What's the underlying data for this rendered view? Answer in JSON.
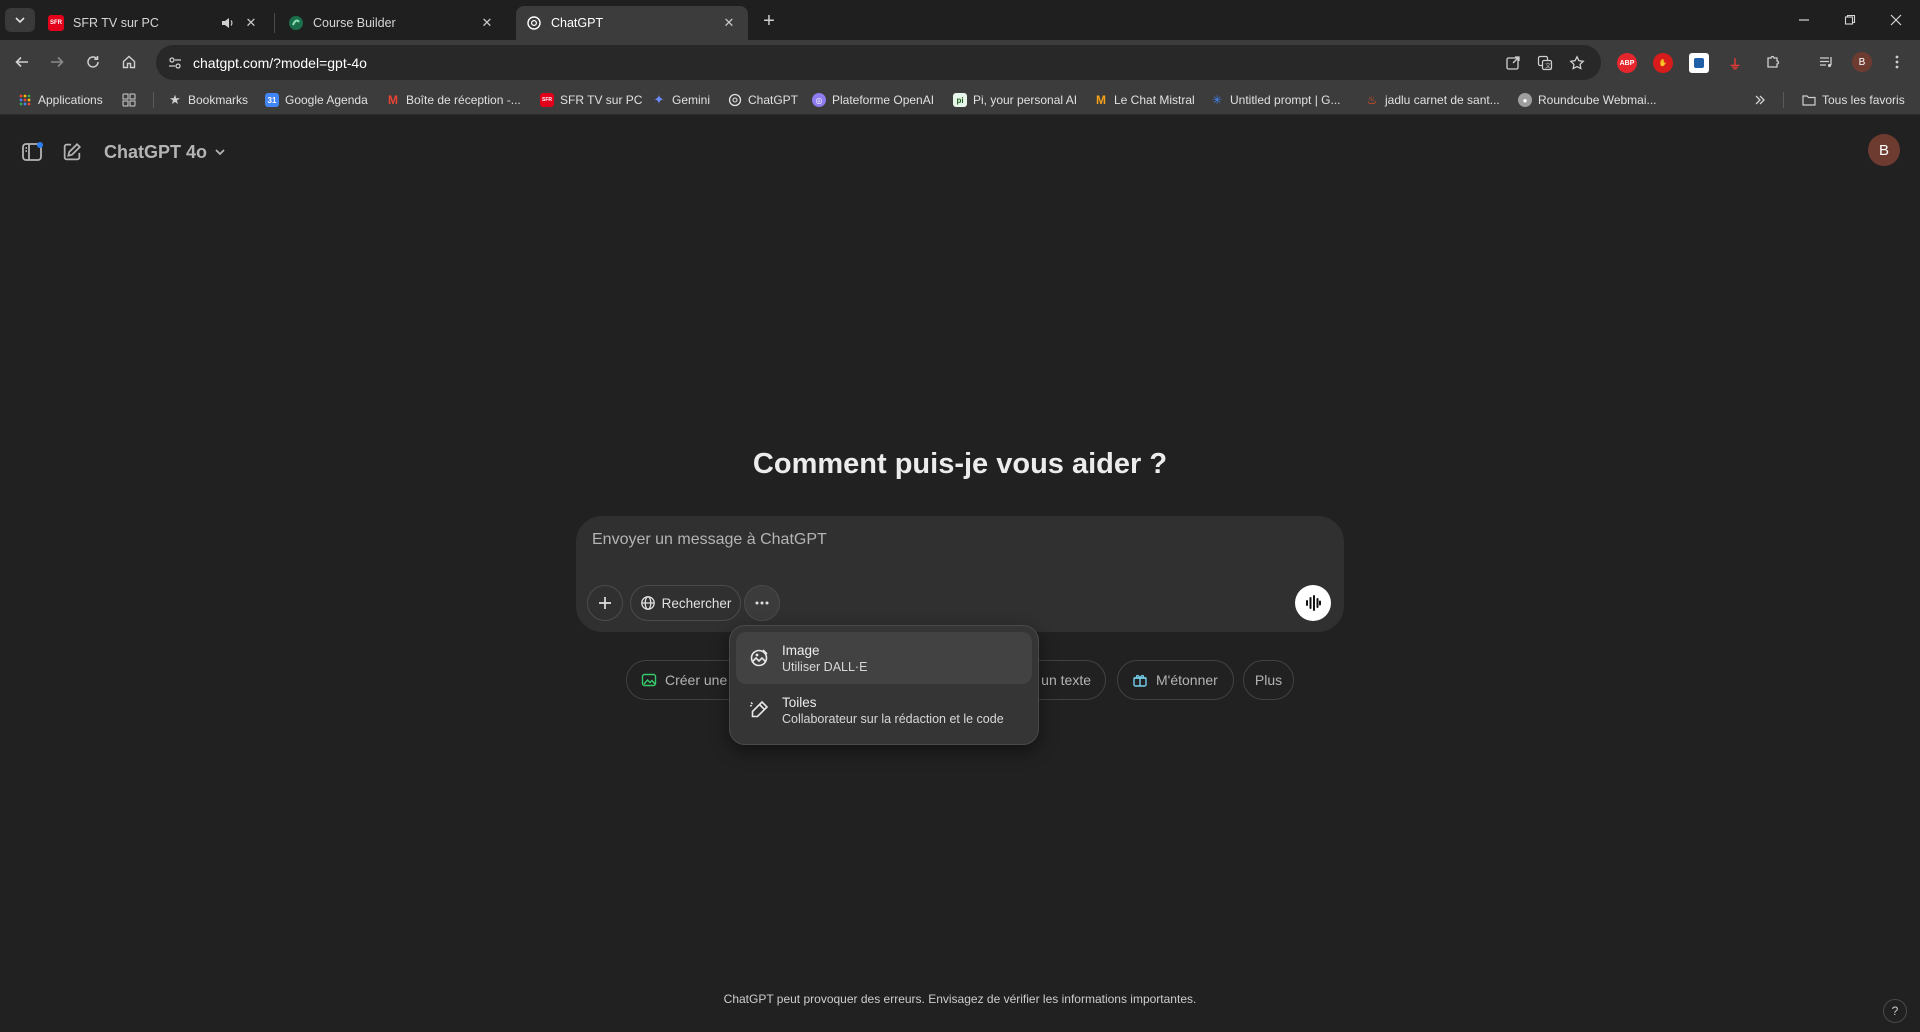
{
  "browser": {
    "tabs": [
      {
        "title": "SFR TV sur PC",
        "favicon": "sfr-icon",
        "audio": true
      },
      {
        "title": "Course Builder",
        "favicon": "course-builder-icon"
      },
      {
        "title": "ChatGPT",
        "favicon": "openai-icon",
        "active": true
      }
    ],
    "url": "chatgpt.com/?model=gpt-4o",
    "avatar_letter": "B",
    "extensions": [
      "adblock-plus-icon",
      "hand-icon",
      "extension-square-icon",
      "pdf-icon",
      "puzzle-icon"
    ]
  },
  "bookmarks": {
    "items": [
      {
        "label": "Applications",
        "icon": "apps-grid-icon"
      },
      {
        "label": "",
        "icon": "grid-icon"
      },
      {
        "label": "Bookmarks",
        "icon": "star-icon"
      },
      {
        "label": "Google Agenda",
        "icon": "google-calendar-icon",
        "color": "#4285f4"
      },
      {
        "label": "Boîte de réception -...",
        "icon": "gmail-icon",
        "color": "#ea4335"
      },
      {
        "label": "SFR TV sur PC",
        "icon": "sfr-icon",
        "color": "#e2001a"
      },
      {
        "label": "Gemini",
        "icon": "gemini-icon",
        "color": "#6b8cff"
      },
      {
        "label": "ChatGPT",
        "icon": "openai-icon",
        "color": "#ffffff"
      },
      {
        "label": "Plateforme OpenAI",
        "icon": "openai-platform-icon",
        "color": "#8e7cf0"
      },
      {
        "label": "Pi, your personal AI",
        "icon": "pi-icon",
        "color": "#2e7d32"
      },
      {
        "label": "Le Chat Mistral",
        "icon": "mistral-icon",
        "color": "#f7a11a"
      },
      {
        "label": "Untitled prompt | G...",
        "icon": "ai-studio-icon",
        "color": "#4285f4"
      },
      {
        "label": "jadlu carnet de sant...",
        "icon": "fire-icon",
        "color": "#f4511e"
      },
      {
        "label": "Roundcube Webmai...",
        "icon": "roundcube-icon",
        "color": "#9e9e9e"
      }
    ],
    "all_bookmarks_label": "Tous les favoris"
  },
  "chat": {
    "model_label": "ChatGPT 4o",
    "user_initial": "B",
    "hero": "Comment puis-je vous aider ?",
    "composer": {
      "placeholder": "Envoyer un message à ChatGPT",
      "search_label": "Rechercher"
    },
    "suggestions": [
      {
        "label": "Créer une",
        "icon": "image-icon",
        "color": "#35c96a"
      },
      {
        "label": "r un texte",
        "icon": ""
      },
      {
        "label": "M'étonner",
        "icon": "gift-icon",
        "color": "#76d0eb"
      },
      {
        "label": "Plus",
        "icon": ""
      }
    ],
    "tools_menu": [
      {
        "title": "Image",
        "subtitle": "Utiliser DALL·E",
        "icon": "image-gen-icon",
        "highlighted": true
      },
      {
        "title": "Toiles",
        "subtitle": "Collaborateur sur la rédaction et le code",
        "icon": "canvas-pen-icon",
        "highlighted": false
      }
    ],
    "disclaimer": "ChatGPT peut provoquer des erreurs. Envisagez de vérifier les informations importantes.",
    "help_label": "?"
  }
}
